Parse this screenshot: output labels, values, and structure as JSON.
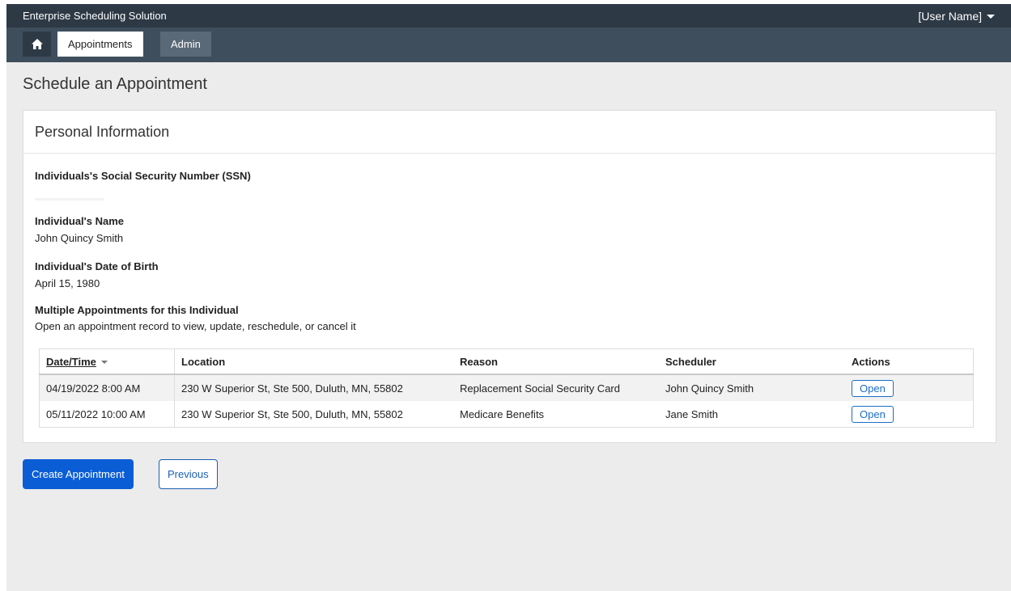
{
  "topbar": {
    "app_title": "Enterprise Scheduling Solution",
    "user_menu": "[User Name]"
  },
  "nav": {
    "tabs": [
      {
        "label": "Appointments"
      },
      {
        "label": "Admin"
      }
    ]
  },
  "page": {
    "title": "Schedule an Appointment"
  },
  "panel": {
    "title": "Personal Information",
    "ssn_label": "Individuals's Social Security Number (SSN)",
    "name_label": "Individual's Name",
    "name_value": "John Quincy Smith",
    "dob_label": "Individual's Date of Birth",
    "dob_value": "April 15, 1980",
    "multi_label": "Multiple Appointments for this Individual",
    "multi_desc": "Open an appointment record to view, update, reschedule, or cancel it"
  },
  "table": {
    "headers": [
      "Date/Time",
      "Location",
      "Reason",
      "Scheduler",
      "Actions"
    ],
    "rows": [
      {
        "datetime": "04/19/2022 8:00 AM",
        "location": "230 W Superior St, Ste 500, Duluth, MN, 55802",
        "reason": "Replacement Social Security Card",
        "scheduler": "John Quincy Smith",
        "action": "Open"
      },
      {
        "datetime": "05/11/2022 10:00 AM",
        "location": "230 W Superior St, Ste 500, Duluth, MN, 55802",
        "reason": "Medicare Benefits",
        "scheduler": "Jane Smith",
        "action": "Open"
      }
    ]
  },
  "buttons": {
    "create": "Create Appointment",
    "previous": "Previous"
  },
  "colors": {
    "topbar": "#2d3945",
    "navbar": "#3f4e5c",
    "primary": "#0b5dd6",
    "background": "#ececec"
  },
  "icons": {
    "home": "home-icon",
    "user_caret": "chevron-down-icon",
    "sort": "sort-down-icon"
  }
}
